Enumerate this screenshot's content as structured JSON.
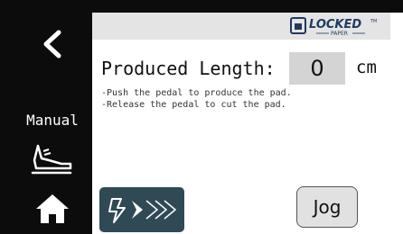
{
  "sidebar": {
    "mode_label": "Manual",
    "back_icon": "chevron-left-icon",
    "mode_icon": "shoe-pedal-icon",
    "home_icon": "home-icon"
  },
  "header": {
    "brand_name": "LOCKED",
    "brand_sub": "PAPER",
    "brand_tm": "TM"
  },
  "production": {
    "length_label": "Produced Length:",
    "length_value": "0",
    "length_unit": "cm",
    "hint_push": "-Push the pedal to produce the pad.",
    "hint_release": "-Release the pedal to cut the pad."
  },
  "controls": {
    "power_icon": "lightning-arrows-icon",
    "jog_label": "Jog"
  },
  "colors": {
    "background": "#0c0c0c",
    "topbar": "#e4e4e4",
    "value_box": "#d4d4d4",
    "power_button": "#2f4a55",
    "jog_button": "#e1e1e1"
  }
}
